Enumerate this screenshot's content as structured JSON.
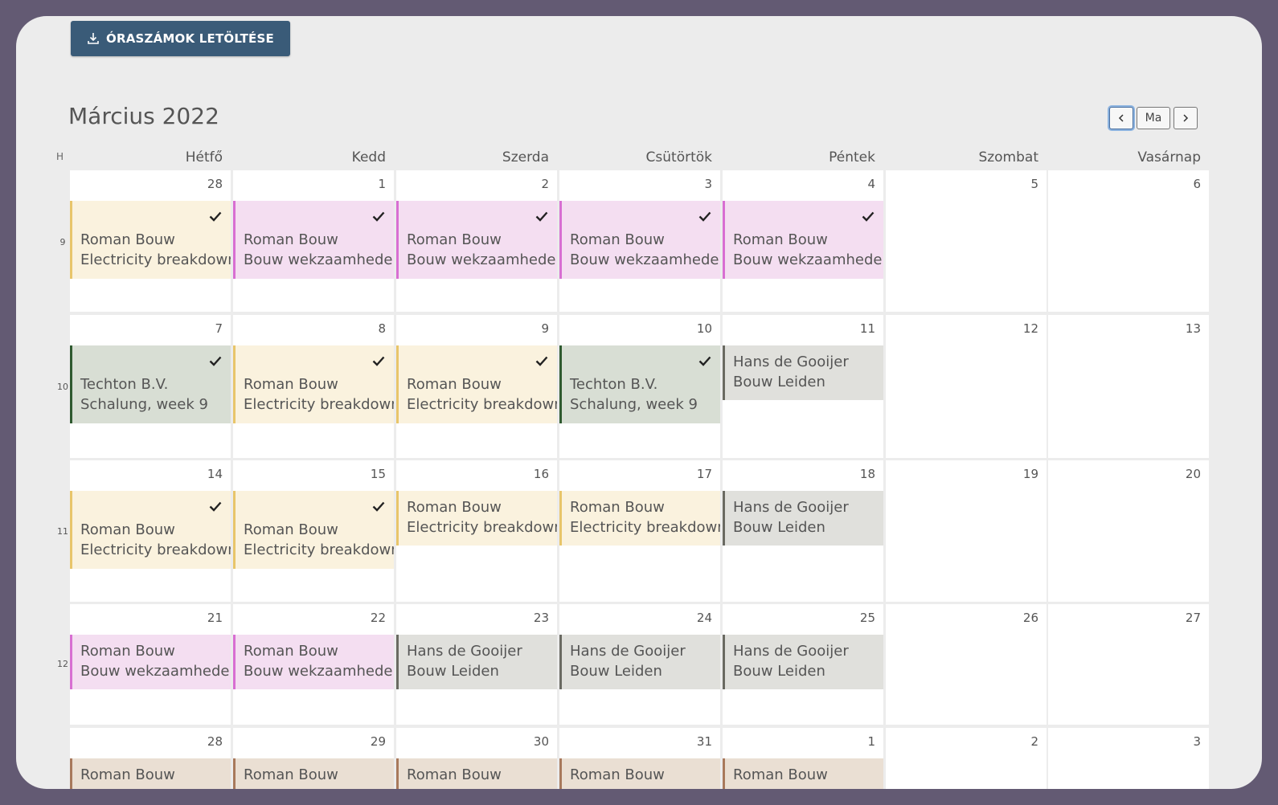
{
  "toolbar": {
    "download_label": "ÓRASZÁMOK LETÖLTÉSE"
  },
  "calendar": {
    "title": "Március 2022",
    "nav": {
      "prev_icon": "chevron-left-icon",
      "today_label": "Ma",
      "next_icon": "chevron-right-icon"
    },
    "week_col_label": "H",
    "day_names": [
      "Hétfő",
      "Kedd",
      "Szerda",
      "Csütörtök",
      "Péntek",
      "Szombat",
      "Vasárnap"
    ],
    "weeks": [
      {
        "week": "9",
        "days": [
          {
            "date": "28",
            "event": {
              "client": "Roman Bouw",
              "project": "Electricity breakdown",
              "color": "yellow",
              "checked": true
            }
          },
          {
            "date": "1",
            "event": {
              "client": "Roman Bouw",
              "project": "Bouw wekzaamheden",
              "color": "pink",
              "checked": true
            }
          },
          {
            "date": "2",
            "event": {
              "client": "Roman Bouw",
              "project": "Bouw wekzaamheden",
              "color": "pink",
              "checked": true
            }
          },
          {
            "date": "3",
            "event": {
              "client": "Roman Bouw",
              "project": "Bouw wekzaamheden",
              "color": "pink",
              "checked": true
            }
          },
          {
            "date": "4",
            "event": {
              "client": "Roman Bouw",
              "project": "Bouw wekzaamheden",
              "color": "pink",
              "checked": true
            }
          },
          {
            "date": "5"
          },
          {
            "date": "6"
          }
        ]
      },
      {
        "week": "10",
        "days": [
          {
            "date": "7",
            "event": {
              "client": "Techton B.V.",
              "project": "Schalung, week 9",
              "color": "green",
              "checked": true
            }
          },
          {
            "date": "8",
            "event": {
              "client": "Roman Bouw",
              "project": "Electricity breakdown",
              "color": "yellow",
              "checked": true
            }
          },
          {
            "date": "9",
            "event": {
              "client": "Roman Bouw",
              "project": "Electricity breakdown",
              "color": "yellow",
              "checked": true
            }
          },
          {
            "date": "10",
            "event": {
              "client": "Techton B.V.",
              "project": "Schalung, week 9",
              "color": "green",
              "checked": true
            }
          },
          {
            "date": "11",
            "event": {
              "client": "Hans de Gooijer",
              "project": "Bouw Leiden",
              "color": "grey",
              "checked": false
            }
          },
          {
            "date": "12"
          },
          {
            "date": "13"
          }
        ]
      },
      {
        "week": "11",
        "days": [
          {
            "date": "14",
            "event": {
              "client": "Roman Bouw",
              "project": "Electricity breakdown",
              "color": "yellow",
              "checked": true
            }
          },
          {
            "date": "15",
            "event": {
              "client": "Roman Bouw",
              "project": "Electricity breakdown",
              "color": "yellow",
              "checked": true
            }
          },
          {
            "date": "16",
            "event": {
              "client": "Roman Bouw",
              "project": "Electricity breakdown",
              "color": "yellow",
              "checked": false
            }
          },
          {
            "date": "17",
            "event": {
              "client": "Roman Bouw",
              "project": "Electricity breakdown",
              "color": "yellow",
              "checked": false
            }
          },
          {
            "date": "18",
            "event": {
              "client": "Hans de Gooijer",
              "project": "Bouw Leiden",
              "color": "grey",
              "checked": false
            }
          },
          {
            "date": "19"
          },
          {
            "date": "20"
          }
        ]
      },
      {
        "week": "12",
        "days": [
          {
            "date": "21",
            "event": {
              "client": "Roman Bouw",
              "project": "Bouw wekzaamheden",
              "color": "pink",
              "checked": false
            }
          },
          {
            "date": "22",
            "event": {
              "client": "Roman Bouw",
              "project": "Bouw wekzaamheden",
              "color": "pink",
              "checked": false
            }
          },
          {
            "date": "23",
            "event": {
              "client": "Hans de Gooijer",
              "project": "Bouw Leiden",
              "color": "grey",
              "checked": false
            }
          },
          {
            "date": "24",
            "event": {
              "client": "Hans de Gooijer",
              "project": "Bouw Leiden",
              "color": "grey",
              "checked": false
            }
          },
          {
            "date": "25",
            "event": {
              "client": "Hans de Gooijer",
              "project": "Bouw Leiden",
              "color": "grey",
              "checked": false
            }
          },
          {
            "date": "26"
          },
          {
            "date": "27"
          }
        ]
      },
      {
        "week": "",
        "days": [
          {
            "date": "28",
            "event": {
              "client": "Roman Bouw",
              "project": "",
              "color": "tan",
              "checked": false
            }
          },
          {
            "date": "29",
            "event": {
              "client": "Roman Bouw",
              "project": "",
              "color": "tan",
              "checked": false
            }
          },
          {
            "date": "30",
            "event": {
              "client": "Roman Bouw",
              "project": "",
              "color": "tan",
              "checked": false
            }
          },
          {
            "date": "31",
            "event": {
              "client": "Roman Bouw",
              "project": "",
              "color": "tan",
              "checked": false
            }
          },
          {
            "date": "1",
            "event": {
              "client": "Roman Bouw",
              "project": "",
              "color": "tan",
              "checked": false
            }
          },
          {
            "date": "2"
          },
          {
            "date": "3"
          }
        ]
      }
    ]
  }
}
